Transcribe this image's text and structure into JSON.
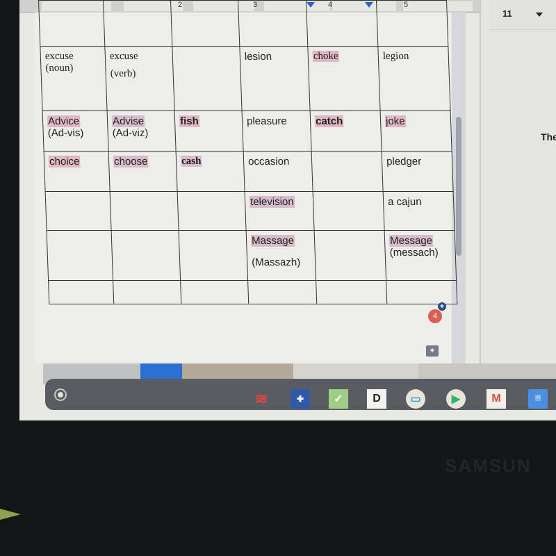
{
  "ruler": {
    "numbers": [
      "2",
      "3",
      "4",
      "5"
    ]
  },
  "toolbar": {
    "font_size": "11"
  },
  "side_panel": {
    "text": "The"
  },
  "table": {
    "rows": [
      [
        "",
        "",
        "",
        "",
        "",
        ""
      ],
      [
        "excuse (noun)",
        "excuse (verb)",
        "",
        "lesion",
        "choke",
        "legion"
      ],
      [
        "Advice (Ad-vis)",
        "Advise (Ad-viz)",
        "fish",
        "pleasure",
        "catch",
        "joke"
      ],
      [
        "choice",
        "choose",
        "cash",
        "occasion",
        "",
        "pledger"
      ],
      [
        "",
        "",
        "",
        "television",
        "",
        "a cajun"
      ],
      [
        "",
        "",
        "",
        "Massage (Massazh)",
        "",
        "Message (messach)"
      ],
      [
        "",
        "",
        "",
        "",
        "",
        ""
      ]
    ],
    "cells": {
      "r1c1a": "excuse",
      "r1c1b": "(noun)",
      "r1c2a": "excuse",
      "r1c2b": "(verb)",
      "r1c4": "lesion",
      "r1c5": "choke",
      "r1c6": "legion",
      "r2c1a": "Advice",
      "r2c1b": "(Ad-vis)",
      "r2c2a": "Advise",
      "r2c2b": "(Ad-viz)",
      "r2c3": "fish",
      "r2c4": "pleasure",
      "r2c5": "catch",
      "r2c6": "joke",
      "r3c1": "choice",
      "r3c2": "choose",
      "r3c3": "cash",
      "r3c4": "occasion",
      "r3c6": "pledger",
      "r4c4": "television",
      "r4c6": "a cajun",
      "r5c4a": "Massage",
      "r5c4b": "(Massazh)",
      "r5c6a": "Message",
      "r5c6b": "(messach)"
    },
    "highlight_color": "#e0b7c4"
  },
  "comments": {
    "count": "4",
    "add_label": "+",
    "suggest_label": "✦"
  },
  "shelf": {
    "apps": [
      {
        "name": "houghton-mifflin-app",
        "glyph": "≋",
        "color": "#e0473c"
      },
      {
        "name": "school-app",
        "glyph": "✚",
        "color": "#2f5aa8"
      },
      {
        "name": "check-app",
        "glyph": "✓",
        "color": "#9fcf86"
      },
      {
        "name": "d-app",
        "glyph": "D",
        "color": "#f3f3f0"
      },
      {
        "name": "zoom-app",
        "glyph": "▭",
        "color": "#e8e6d8"
      },
      {
        "name": "play-store-app",
        "glyph": "▶",
        "color": "#e8e6d8"
      },
      {
        "name": "gmail-app",
        "glyph": "M",
        "color": "#f1efe9"
      },
      {
        "name": "docs-app",
        "glyph": "≡",
        "color": "#4a8fe0"
      }
    ]
  },
  "device": {
    "brand": "SAMSUN"
  }
}
